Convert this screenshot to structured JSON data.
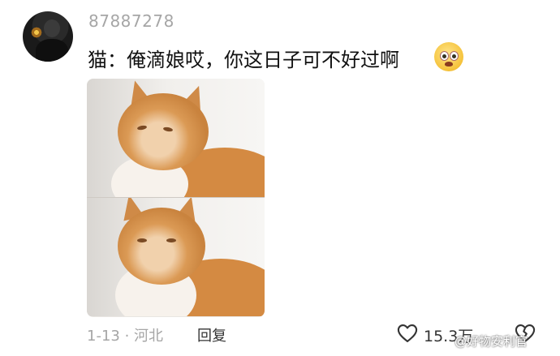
{
  "comment": {
    "username": "87887278",
    "text": "猫：俺滴娘哎，你这日子可不好过啊",
    "emoji": "woozy-crying-face-emoji",
    "date_location": "1-13 · 河北",
    "reply_label": "回复",
    "like_count": "15.3万"
  },
  "watermark": "@好物安利官"
}
